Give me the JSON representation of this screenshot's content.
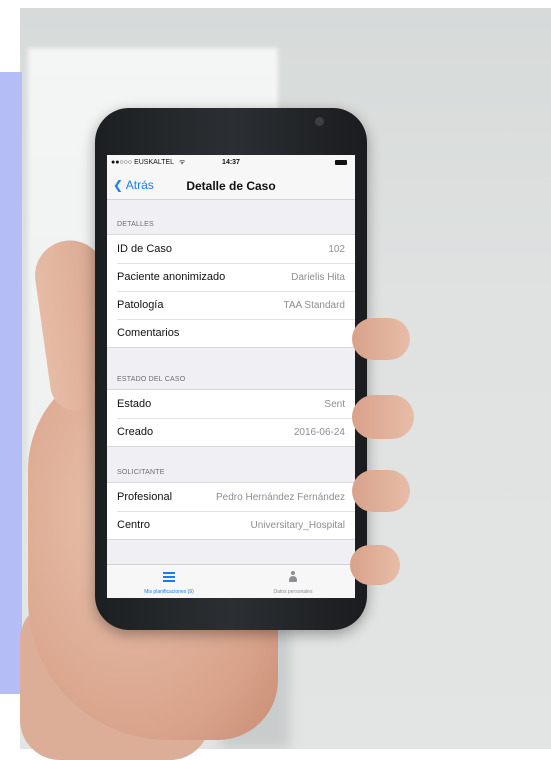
{
  "status_bar": {
    "carrier": "●●○○○ EUSKALTEL",
    "wifi_icon": "wifi-icon",
    "time": "14:37",
    "battery_icon": "battery-icon"
  },
  "nav_bar": {
    "back_label": "Atrás",
    "title": "Detalle de Caso",
    "accent_color": "#1a7cf5"
  },
  "sections": [
    {
      "header": "DETALLES",
      "rows": [
        {
          "label": "ID de Caso",
          "value": "102"
        },
        {
          "label": "Paciente anonimizado",
          "value": "Darielis Hita"
        },
        {
          "label": "Patología",
          "value": "TAA Standard"
        },
        {
          "label": "Comentarios",
          "value": ""
        }
      ]
    },
    {
      "header": "ESTADO DEL CASO",
      "rows": [
        {
          "label": "Estado",
          "value": "Sent"
        },
        {
          "label": "Creado",
          "value": "2016-06-24"
        }
      ]
    },
    {
      "header": "SOLICITANTE",
      "rows": [
        {
          "label": "Profesional",
          "value": "Pedro Hernández Fernández"
        },
        {
          "label": "Centro",
          "value": "Universitary_Hospital"
        }
      ]
    }
  ],
  "tab_bar": {
    "tabs": [
      {
        "label": "Mis planificaciones (9)",
        "icon": "list-icon",
        "active": true
      },
      {
        "label": "Datos personales",
        "icon": "person-icon",
        "active": false
      }
    ]
  }
}
